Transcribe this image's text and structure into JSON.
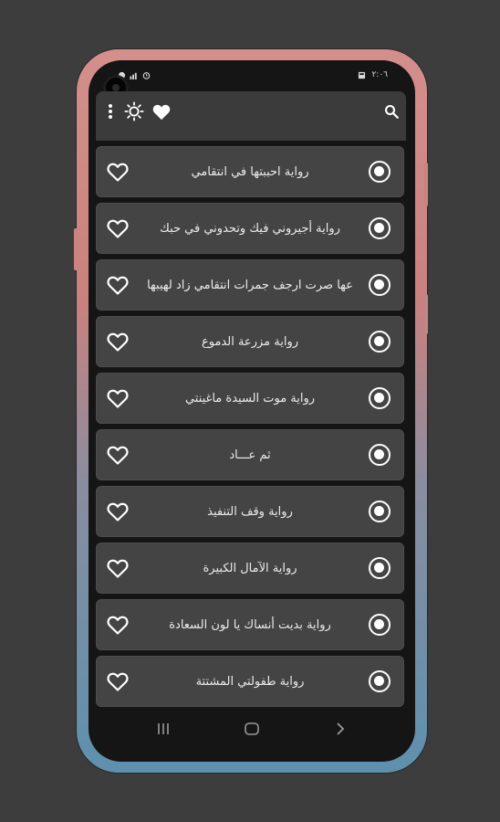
{
  "status_bar": {
    "time": "٢:٠٦",
    "icons": [
      "notification-icon",
      "signal-icon",
      "alarm-icon",
      "battery-icon"
    ]
  },
  "toolbar": {
    "icons": [
      "more-vert-icon",
      "brightness-icon",
      "favorite-icon",
      "search-icon"
    ]
  },
  "novels": [
    {
      "title": "رواية احببتها في انتقامي",
      "favorite": false,
      "selected": true
    },
    {
      "title": "رواية  أجيروني فيك وتحدوني في حبك",
      "favorite": false,
      "selected": true
    },
    {
      "title": "عها صرت ارجف جمرات انتقامي  زاد لهيبها",
      "favorite": false,
      "selected": true
    },
    {
      "title": "رواية مزرعة الدموع",
      "favorite": false,
      "selected": true
    },
    {
      "title": "رواية موت السيدة ماغينتي",
      "favorite": false,
      "selected": true
    },
    {
      "title": "ثم عـــاد",
      "favorite": false,
      "selected": true
    },
    {
      "title": "رواية وقف التنفيذ",
      "favorite": false,
      "selected": true
    },
    {
      "title": "رواية الآمال الكبيرة",
      "favorite": false,
      "selected": true
    },
    {
      "title": "رواية بديت أنساك يا لون السعادة",
      "favorite": false,
      "selected": true
    },
    {
      "title": "رواية طفولتي المشتتة",
      "favorite": false,
      "selected": true
    }
  ],
  "nav_bar": {
    "icons": [
      "recent-apps-icon",
      "home-icon",
      "back-icon"
    ]
  },
  "colors": {
    "background": "#3d3d3d",
    "item_background": "#444444",
    "text": "#ececec"
  }
}
